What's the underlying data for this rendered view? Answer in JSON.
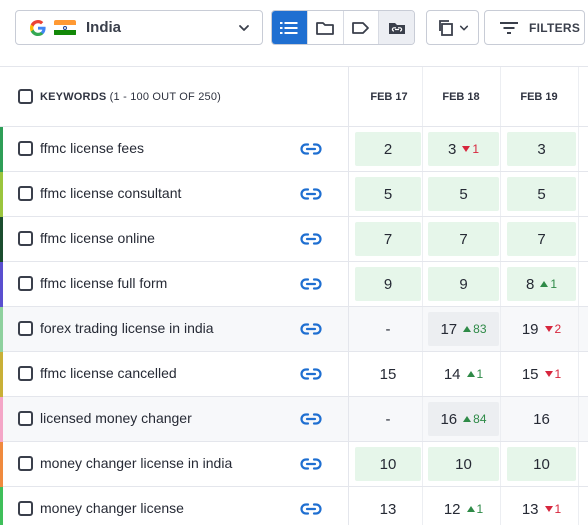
{
  "toolbar": {
    "search_engine_icon": "google-g-icon",
    "country_flag": "india-flag-icon",
    "country": "India",
    "view_buttons": [
      "list-view-icon",
      "folder-icon",
      "tag-icon",
      "tag-folder-icon"
    ],
    "copy_icon": "copy-icon",
    "filters_label": "FILTERS"
  },
  "table": {
    "header_title": "KEYWORDS",
    "header_subtitle": "(1 - 100 OUT OF 250)",
    "dates": [
      "FEB 17",
      "FEB 18",
      "FEB 19"
    ],
    "rows": [
      {
        "keyword": "ffmc license fees",
        "accent": "#2e9e57",
        "alt": false,
        "ranks": [
          {
            "v": "2",
            "bg": "green"
          },
          {
            "v": "3",
            "bg": "green",
            "chg": "1",
            "dir": "down"
          },
          {
            "v": "3",
            "bg": "green"
          }
        ]
      },
      {
        "keyword": "ffmc license consultant",
        "accent": "#9bc53d",
        "alt": false,
        "ranks": [
          {
            "v": "5",
            "bg": "green"
          },
          {
            "v": "5",
            "bg": "green"
          },
          {
            "v": "5",
            "bg": "green"
          }
        ]
      },
      {
        "keyword": "ffmc license online",
        "accent": "#1b4d2e",
        "alt": false,
        "ranks": [
          {
            "v": "7",
            "bg": "green"
          },
          {
            "v": "7",
            "bg": "green"
          },
          {
            "v": "7",
            "bg": "green"
          }
        ]
      },
      {
        "keyword": "ffmc license full form",
        "accent": "#5a4fcf",
        "alt": false,
        "ranks": [
          {
            "v": "9",
            "bg": "green"
          },
          {
            "v": "9",
            "bg": "green"
          },
          {
            "v": "8",
            "bg": "green",
            "chg": "1",
            "dir": "up"
          }
        ]
      },
      {
        "keyword": "forex trading license in india",
        "accent": "#8fd19e",
        "alt": true,
        "ranks": [
          {
            "v": "-",
            "bg": "none"
          },
          {
            "v": "17",
            "bg": "grey",
            "chg": "83",
            "dir": "up"
          },
          {
            "v": "19",
            "bg": "none",
            "chg": "2",
            "dir": "down"
          }
        ]
      },
      {
        "keyword": "ffmc license cancelled",
        "accent": "#c9b037",
        "alt": false,
        "ranks": [
          {
            "v": "15",
            "bg": "none"
          },
          {
            "v": "14",
            "bg": "none",
            "chg": "1",
            "dir": "up"
          },
          {
            "v": "15",
            "bg": "none",
            "chg": "1",
            "dir": "down"
          }
        ]
      },
      {
        "keyword": "licensed money changer",
        "accent": "#f4a6c7",
        "alt": true,
        "ranks": [
          {
            "v": "-",
            "bg": "none"
          },
          {
            "v": "16",
            "bg": "grey",
            "chg": "84",
            "dir": "up"
          },
          {
            "v": "16",
            "bg": "none"
          }
        ]
      },
      {
        "keyword": "money changer license in india",
        "accent": "#f08a3e",
        "alt": false,
        "ranks": [
          {
            "v": "10",
            "bg": "green"
          },
          {
            "v": "10",
            "bg": "green"
          },
          {
            "v": "10",
            "bg": "green"
          }
        ]
      },
      {
        "keyword": "money changer license",
        "accent": "#3fbf5a",
        "alt": false,
        "ranks": [
          {
            "v": "13",
            "bg": "none"
          },
          {
            "v": "12",
            "bg": "none",
            "chg": "1",
            "dir": "up"
          },
          {
            "v": "13",
            "bg": "none",
            "chg": "1",
            "dir": "down"
          }
        ]
      }
    ]
  }
}
